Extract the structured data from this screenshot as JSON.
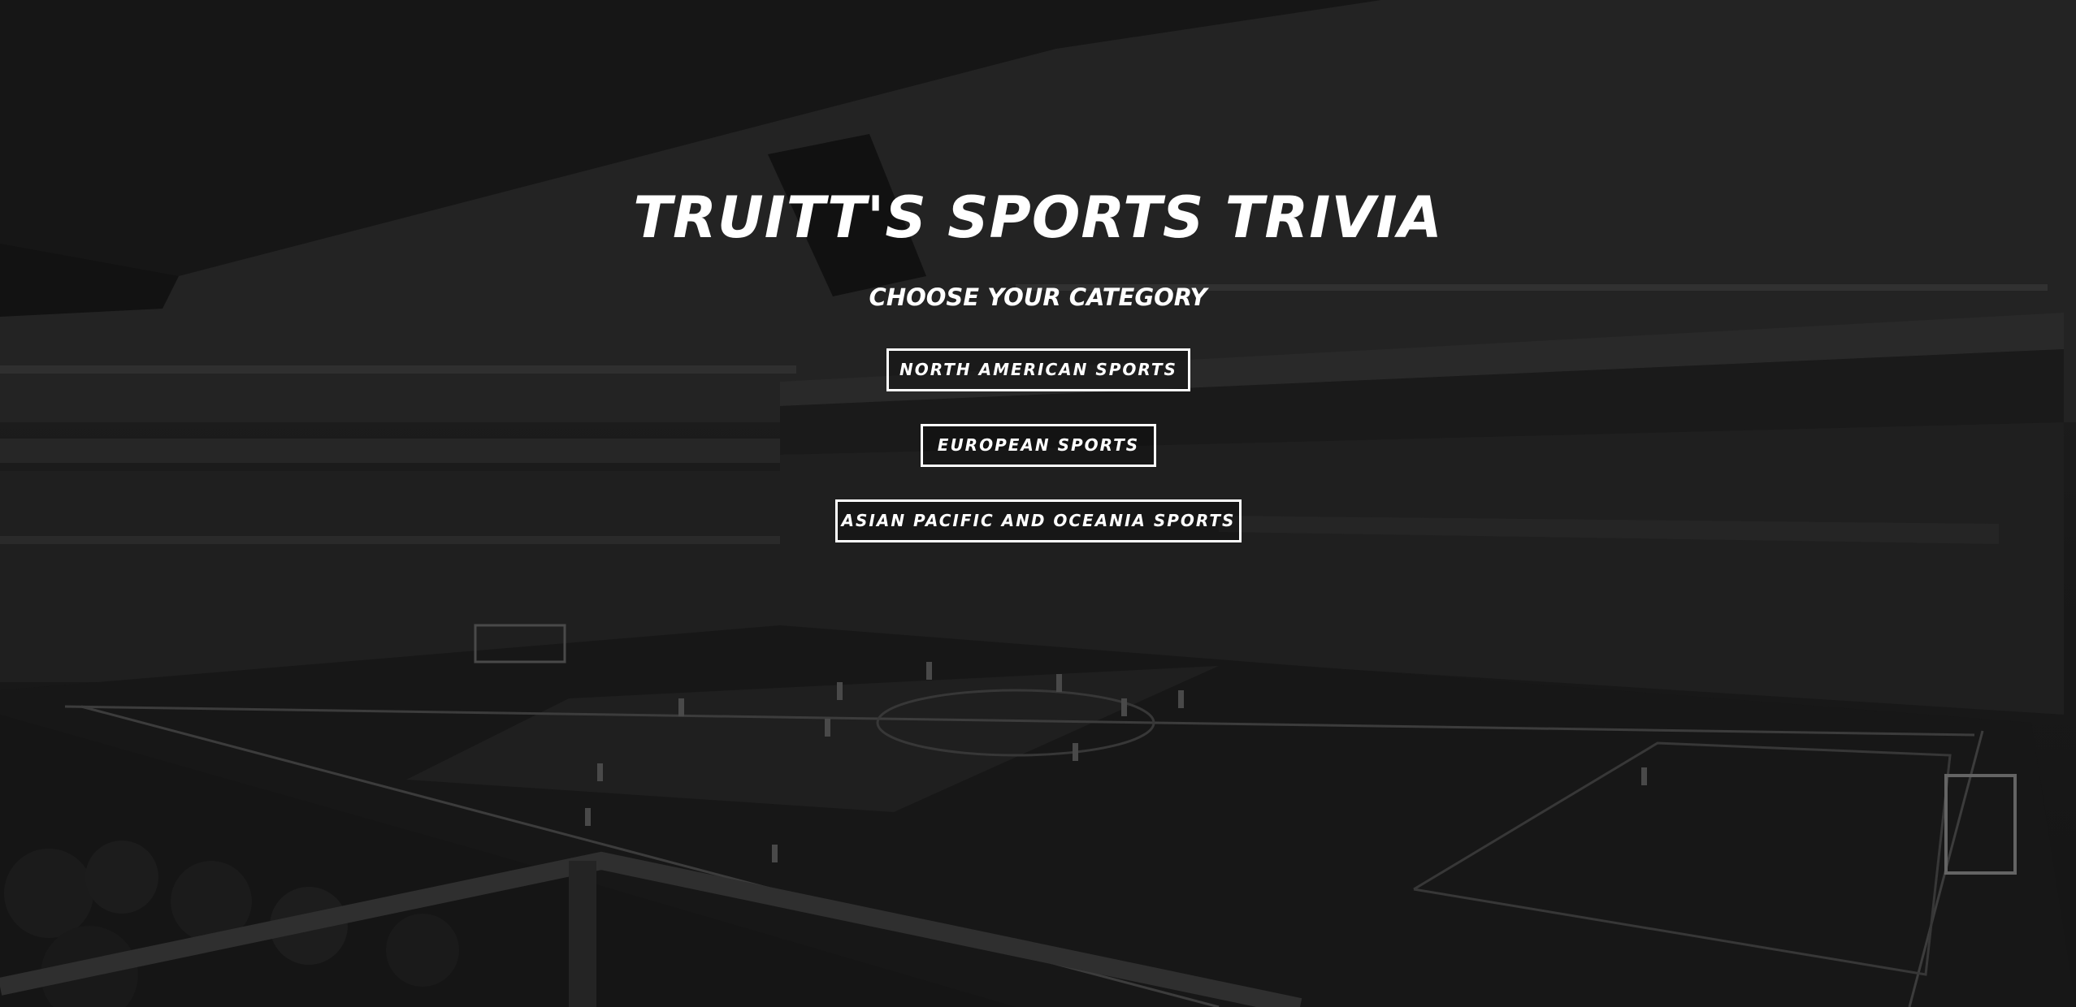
{
  "app": {
    "title": "TRUITT'S SPORTS TRIVIA",
    "subtitle": "CHOOSE YOUR CATEGORY"
  },
  "categories": [
    {
      "label": "NORTH AMERICAN SPORTS"
    },
    {
      "label": "EUROPEAN SPORTS"
    },
    {
      "label": "ASIAN PACIFIC AND OCEANIA SPORTS"
    }
  ],
  "background": {
    "scene": "stadium-photo",
    "tint": "#1e1e1e"
  },
  "colors": {
    "text": "#ffffff",
    "button_border": "#ffffff"
  }
}
